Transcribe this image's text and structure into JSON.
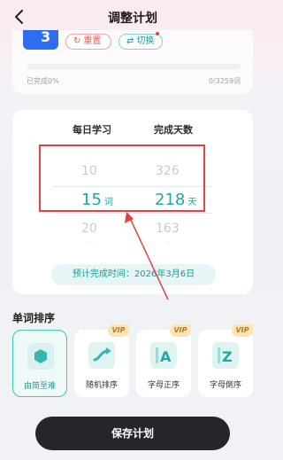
{
  "header": {
    "title": "调整计划"
  },
  "book": {
    "number": "3"
  },
  "actions": {
    "reset_label": "重置",
    "switch_label": "切换"
  },
  "progress": {
    "completed_text": "已完成0%",
    "count_text": "0/3259词",
    "fraction": 0
  },
  "plan": {
    "daily_header": "每日学习",
    "days_header": "完成天数",
    "daily_above": "10",
    "daily_selected": "15",
    "daily_unit": "词",
    "daily_below": "20",
    "days_above": "326",
    "days_selected": "218",
    "days_unit": "天",
    "days_below": "163",
    "finish_text": "预计完成时间：2026年3月6日"
  },
  "sorting": {
    "title": "单词排序",
    "options": [
      {
        "label": "由简至难",
        "selected": true,
        "vip": false,
        "icon": "hexagon-icon"
      },
      {
        "label": "随机排序",
        "selected": false,
        "vip": true,
        "icon": "shuffle-icon"
      },
      {
        "label": "字母正序",
        "selected": false,
        "vip": true,
        "icon": "letter-a-icon"
      },
      {
        "label": "字母倒序",
        "selected": false,
        "vip": true,
        "icon": "letter-z-icon"
      }
    ],
    "vip_label": "VIP"
  },
  "save_label": "保存计划",
  "colors": {
    "accent": "#1fa99f",
    "highlight_box": "#e04444",
    "dark_button": "#24262c"
  }
}
